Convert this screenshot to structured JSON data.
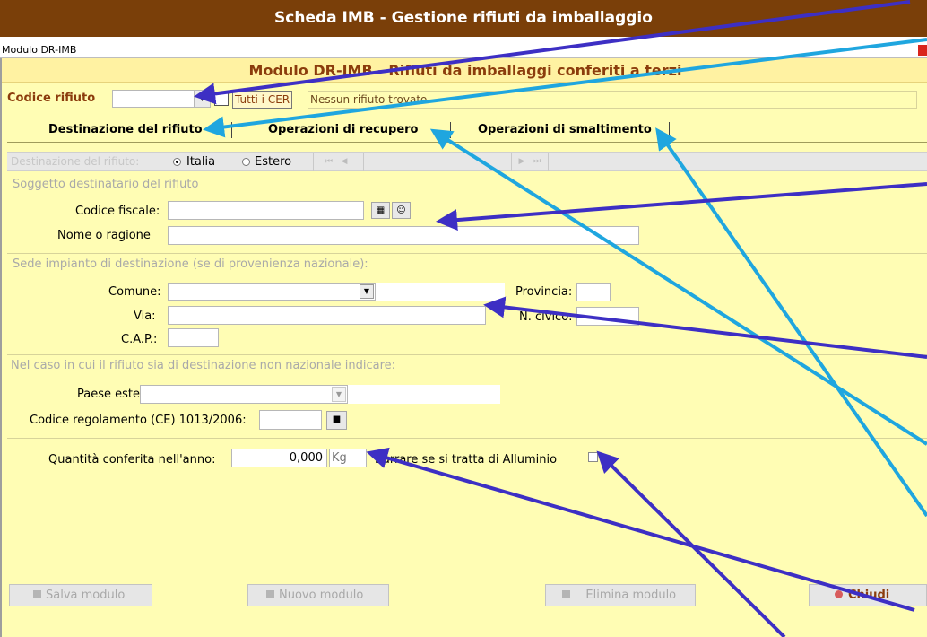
{
  "app": {
    "title": "Scheda IMB - Gestione rifiuti da imballaggio",
    "window_title": "Modulo DR-IMB",
    "form_title": "Modulo DR-IMB - Rifiuti da imballaggi conferiti a terzi"
  },
  "top_row": {
    "codice_label": "Codice rifiuto",
    "codice_value": "",
    "tutti_label": "Tutti i CER",
    "status_text": "Nessun rifiuto trovato."
  },
  "tabs": [
    {
      "label": "Destinazione del rifiuto"
    },
    {
      "label": "Operazioni di recupero"
    },
    {
      "label": "Operazioni di smaltimento"
    }
  ],
  "nav": {
    "label": "Destinazione del rifiuto:",
    "option_italia": "Italia",
    "option_estero": "Estero",
    "selected": "Italia",
    "first": "⏮",
    "prev": "◀",
    "next": "▶",
    "last": "⏭"
  },
  "soggetto": {
    "section_label": "Soggetto destinatario del rifiuto",
    "codice_fiscale_label": "Codice fiscale:",
    "codice_fiscale_value": "",
    "nome_label": "Nome o ragione",
    "nome_value": ""
  },
  "sede": {
    "section_label": "Sede impianto di destinazione (se di provenienza nazionale):",
    "comune_label": "Comune:",
    "comune_value": "",
    "provincia_label": "Provincia:",
    "provincia_value": "",
    "via_label": "Via:",
    "via_value": "",
    "civico_label": "N. civico:",
    "civico_value": "",
    "cap_label": "C.A.P.:",
    "cap_value": ""
  },
  "estero": {
    "section_label": "Nel caso in cui il rifiuto sia di destinazione non nazionale indicare:",
    "paese_label": "Paese estero:",
    "paese_value": "",
    "regolamento_label": "Codice regolamento (CE) 1013/2006:",
    "regolamento_value": ""
  },
  "quantita": {
    "label": "Quantità conferita nell'anno:",
    "value": "0,000",
    "unit": "Kg",
    "alluminio_label": "Barrare se si tratta di Alluminio"
  },
  "buttons": {
    "salva": "Salva modulo",
    "nuovo": "Nuovo modulo",
    "elimina": "Elimina modulo",
    "chiudi": "Chiudi"
  },
  "colors": {
    "titlebar": "#7a3f09",
    "form_bg": "#fffdb4",
    "label_brown": "#8b3c0c",
    "arrow_dark": "#3d2fc4",
    "arrow_light": "#1fa6df",
    "close_icon": "#d9251d"
  },
  "icons": [
    "calendar-icon",
    "person-icon",
    "dropdown-arrow-icon",
    "close-icon",
    "stop-icon"
  ]
}
